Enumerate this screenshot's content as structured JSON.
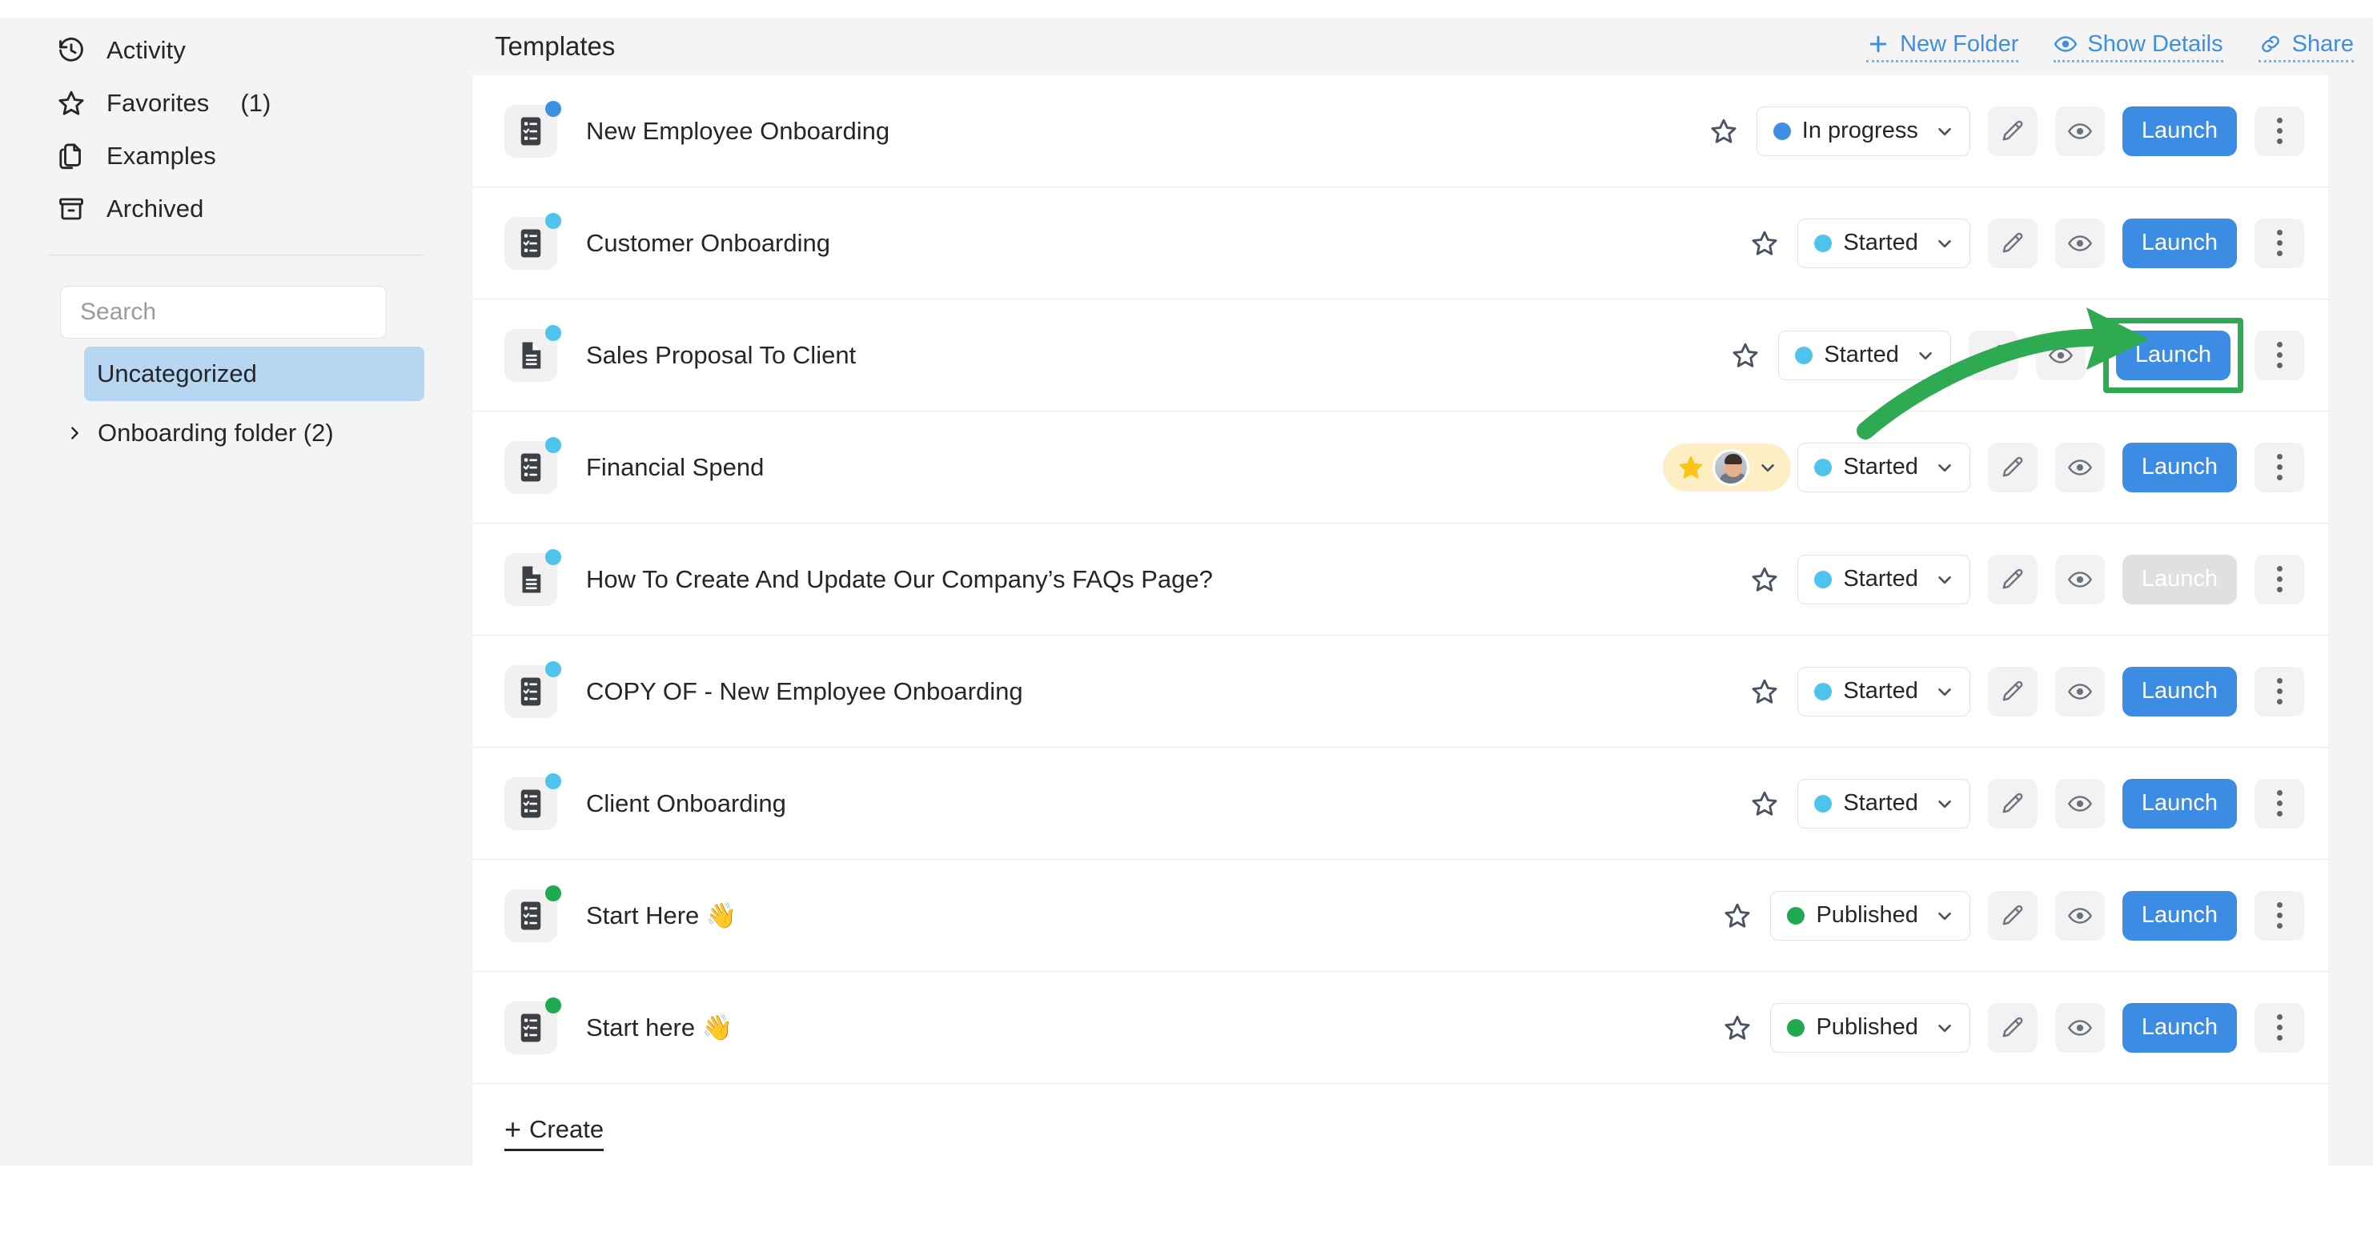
{
  "sidebar": {
    "items": [
      {
        "label": "Activity",
        "icon": "history-icon",
        "count": ""
      },
      {
        "label": "Favorites",
        "icon": "star-icon",
        "count": "(1)"
      },
      {
        "label": "Examples",
        "icon": "copy-icon",
        "count": ""
      },
      {
        "label": "Archived",
        "icon": "archive-icon",
        "count": ""
      }
    ],
    "search": {
      "value": "",
      "placeholder": "Search"
    },
    "selected_folder": "Uncategorized",
    "folders": [
      {
        "label": "Onboarding folder (2)",
        "expanded": false
      }
    ]
  },
  "header": {
    "title": "Templates",
    "actions": [
      {
        "label": "New Folder",
        "icon": "plus-icon"
      },
      {
        "label": "Show Details",
        "icon": "eye-icon"
      },
      {
        "label": "Share",
        "icon": "link-icon"
      }
    ]
  },
  "table": {
    "rows": [
      {
        "title": "New Employee Onboarding",
        "icon": "checklist-icon",
        "badge_color": "blue",
        "favorited": false,
        "status": "In progress",
        "status_kind": "inprogress",
        "launch_label": "Launch",
        "launch_disabled": false,
        "highlighted": false
      },
      {
        "title": "Customer Onboarding",
        "icon": "checklist-icon",
        "badge_color": "cyan",
        "favorited": false,
        "status": "Started",
        "status_kind": "started",
        "launch_label": "Launch",
        "launch_disabled": false,
        "highlighted": false
      },
      {
        "title": "Sales Proposal To Client",
        "icon": "document-icon",
        "badge_color": "cyan",
        "favorited": false,
        "status": "Started",
        "status_kind": "started",
        "launch_label": "Launch",
        "launch_disabled": false,
        "highlighted": true
      },
      {
        "title": "Financial Spend",
        "icon": "checklist-icon",
        "badge_color": "cyan",
        "favorited": true,
        "status": "Started",
        "status_kind": "started",
        "launch_label": "Launch",
        "launch_disabled": false,
        "highlighted": false
      },
      {
        "title": "How To Create And Update Our Company’s FAQs Page?",
        "icon": "document-icon",
        "badge_color": "cyan",
        "favorited": false,
        "status": "Started",
        "status_kind": "started",
        "launch_label": "Launch",
        "launch_disabled": true,
        "highlighted": false
      },
      {
        "title": "COPY OF - New Employee Onboarding",
        "icon": "checklist-icon",
        "badge_color": "cyan",
        "favorited": false,
        "status": "Started",
        "status_kind": "started",
        "launch_label": "Launch",
        "launch_disabled": false,
        "highlighted": false
      },
      {
        "title": "Client Onboarding",
        "icon": "checklist-icon",
        "badge_color": "cyan",
        "favorited": false,
        "status": "Started",
        "status_kind": "started",
        "launch_label": "Launch",
        "launch_disabled": false,
        "highlighted": false
      },
      {
        "title": "Start Here 👋",
        "icon": "checklist-icon",
        "badge_color": "green",
        "favorited": false,
        "status": "Published",
        "status_kind": "published",
        "launch_label": "Launch",
        "launch_disabled": false,
        "highlighted": false
      },
      {
        "title": "Start here 👋",
        "icon": "checklist-icon",
        "badge_color": "green",
        "favorited": false,
        "status": "Published",
        "status_kind": "published",
        "launch_label": "Launch",
        "launch_disabled": false,
        "highlighted": false
      }
    ],
    "create_label": "Create",
    "create_plus": "+"
  },
  "annotation": {
    "color": "#2eaa52",
    "target": "Launch button on Sales Proposal To Client row"
  },
  "colors": {
    "accent_blue": "#3b8ce2",
    "status_inprogress": "#3f8fe0",
    "status_started": "#4ec3ec",
    "status_published": "#1faa52",
    "highlight_green": "#2eaa52",
    "favorite_pill": "#fdeec4",
    "favorite_star": "#fcc419",
    "panel_bg": "#f4f4f4",
    "selected_folder_bg": "#b7d6f2"
  }
}
